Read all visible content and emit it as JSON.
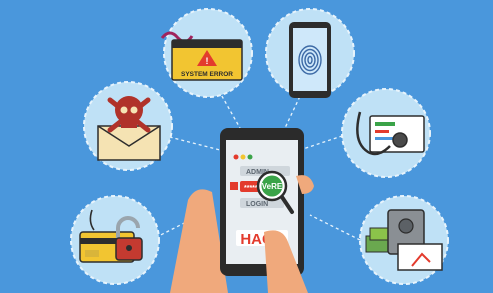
{
  "scene": {
    "background_color": "#4a97dc",
    "circle_color": "#bfe1f6",
    "dash_color": "#e8f4fc"
  },
  "illustration": {
    "warning_window": {
      "text": "SYSTEM ERROR",
      "icon": "warning-triangle-icon"
    },
    "fingerprint_phone": {
      "icon": "fingerprint-icon"
    },
    "skull_envelope": {
      "icon": "skull-crossbones-icon"
    },
    "stethoscope_monitor": {
      "icon": "stethoscope-icon"
    },
    "credit_card_padlock": {
      "icon": "open-padlock-icon"
    },
    "money_safe": {
      "icon": "safe-icon"
    },
    "phone_screen": {
      "username_label": "ADMIN",
      "password_label": "LOGIN",
      "virus_badge": "VeRE",
      "hack_text": "HACK",
      "password_mask": "*****"
    }
  }
}
